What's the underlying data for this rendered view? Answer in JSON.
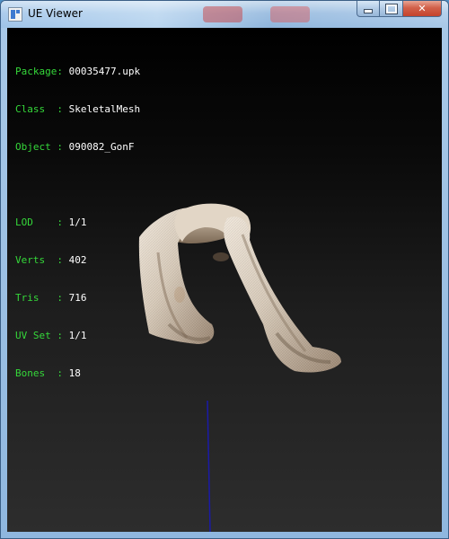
{
  "window": {
    "title": "UE Viewer",
    "minimize_symbol": "",
    "maximize_symbol": "",
    "close_symbol": "✕"
  },
  "info": {
    "package": {
      "label": "Package:",
      "value": "00035477.upk"
    },
    "class": {
      "label": "Class  :",
      "value": "SkeletalMesh"
    },
    "object": {
      "label": "Object :",
      "value": "090082_GonF"
    },
    "lod": {
      "label": "LOD    :",
      "value": "1/1"
    },
    "verts": {
      "label": "Verts  :",
      "value": "402"
    },
    "tris": {
      "label": "Tris   :",
      "value": "716"
    },
    "uvset": {
      "label": "UV Set :",
      "value": "1/1"
    },
    "bones": {
      "label": "Bones  :",
      "value": "18"
    }
  },
  "colors": {
    "label": "#35d83a",
    "value": "#ffffff",
    "axis": "#1a1aa8",
    "towel_light": "#e6ddd0",
    "towel_dark": "#8c7a66"
  },
  "icons": {
    "app": "ue-viewer-app-icon",
    "minimize": "minimize-icon",
    "maximize": "maximize-icon",
    "close": "close-icon"
  }
}
